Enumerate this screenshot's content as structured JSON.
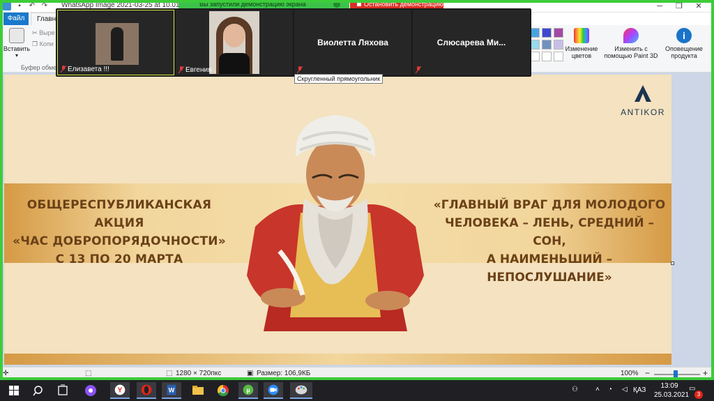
{
  "window": {
    "title": "WhatsApp Image 2021-03-25 at 10.01.38",
    "minimize_glyph": "─",
    "maximize_glyph": "❐",
    "close_glyph": "✕"
  },
  "share": {
    "banner_text": "Вы запустили демонстрацию экрана",
    "stop_label": "Остановить демонстрацию"
  },
  "ribbon": {
    "tabs": [
      "Файл",
      "Главная"
    ],
    "paste_label": "Вставить",
    "cut_label": "Выре",
    "copy_label": "Копи",
    "clipboard_group": "Буфер обмен",
    "edit_colors_label": "Изменение цветов",
    "paint3d_label": "Изменить с помощью Paint 3D",
    "product_alert_label": "Оповещение продукта"
  },
  "zoom": {
    "participants": [
      {
        "name": "Елизавета !!!",
        "has_video": true,
        "active": true
      },
      {
        "name": "Евгения .",
        "has_video": true,
        "active": false
      },
      {
        "name": "Виолетта Ляхова",
        "has_video": false,
        "active": false
      },
      {
        "name": "Слюсарева  Ми...",
        "has_video": false,
        "active": false
      }
    ],
    "tooltip": "Скругленный прямоугольник"
  },
  "poster": {
    "left_lines": [
      "ОБЩЕРЕСПУБЛИКАНСКАЯ АКЦИЯ",
      "«ЧАС ДОБРОПОРЯДОЧНОСТИ»",
      "С 13 ПО 20 МАРТА"
    ],
    "right_lines": [
      "«ГЛАВНЫЙ ВРАГ ДЛЯ МОЛОДОГО",
      "ЧЕЛОВЕКА – ЛЕНЬ, СРЕДНИЙ –СОН,",
      "А НАИМЕНЬШИЙ – НЕПОСЛУШАНИЕ»"
    ],
    "brand_name": "ANTIKOR",
    "colors": {
      "text": "#6b4118",
      "band": "#d59a45",
      "background": "#f4e2c0"
    }
  },
  "statusbar": {
    "dimensions": "1280 × 720пкс",
    "size": "Размер: 106,9КБ",
    "zoom": "100%",
    "zoom_minus": "−",
    "zoom_plus": "+",
    "zoom_level": 0.5
  },
  "taskbar": {
    "apps": [
      "windows-start",
      "search",
      "task-view",
      "alice",
      "yandex-browser",
      "opera",
      "word",
      "file-explorer",
      "chrome",
      "utorrent",
      "zoom",
      "paint"
    ],
    "language": "ҚАЗ",
    "time": "13:09",
    "date": "25.03.2021",
    "notifications": "3"
  }
}
